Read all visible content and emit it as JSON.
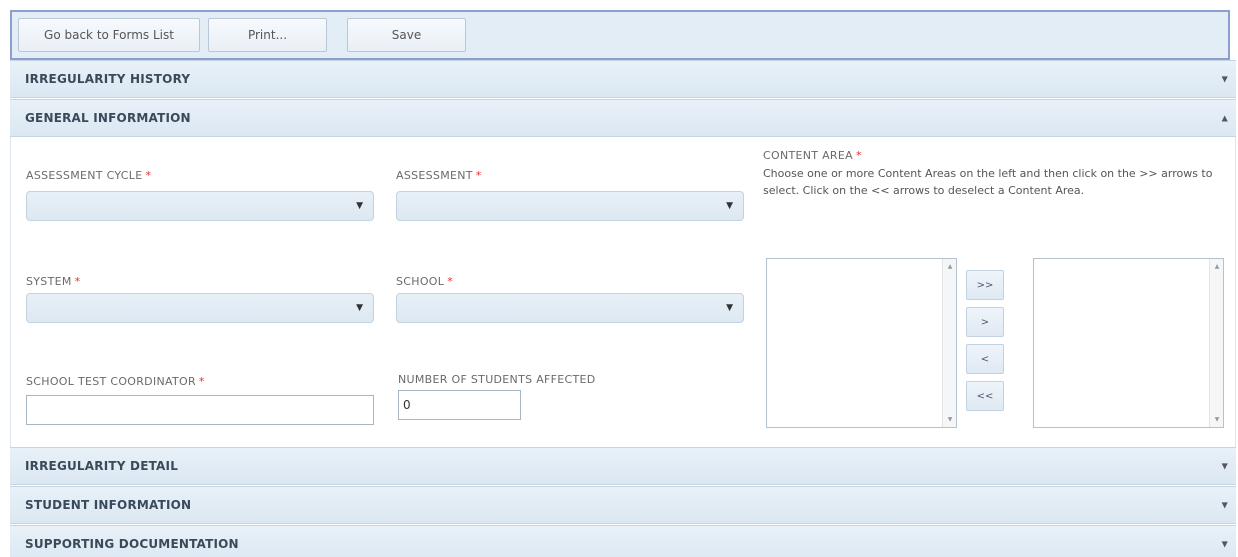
{
  "toolbar": {
    "back_label": "Go back to Forms List",
    "print_label": "Print...",
    "save_label": "Save"
  },
  "sections": {
    "irregularity_history": "IRREGULARITY HISTORY",
    "general_information": "GENERAL INFORMATION",
    "irregularity_detail": "IRREGULARITY DETAIL",
    "student_information": "STUDENT INFORMATION",
    "supporting_documentation": "SUPPORTING DOCUMENTATION"
  },
  "fields": {
    "assessment_cycle": "ASSESSMENT CYCLE",
    "assessment": "ASSESSMENT",
    "system": "SYSTEM",
    "school": "SCHOOL",
    "school_test_coordinator": "SCHOOL TEST COORDINATOR",
    "number_of_students_affected": "NUMBER OF STUDENTS AFFECTED",
    "number_of_students_value": "0",
    "required_marker": "*"
  },
  "content_area": {
    "label": "CONTENT AREA",
    "description": "Choose one or more Content Areas on the left and then click on the >> arrows to select. Click on the << arrows to deselect a Content Area.",
    "buttons": {
      "add_all": ">>",
      "add_one": ">",
      "remove_one": "<",
      "remove_all": "<<"
    }
  },
  "icons": {
    "caret_down": "▼",
    "caret_up": "▲",
    "scroll_up": "▲",
    "scroll_down": "▼"
  }
}
